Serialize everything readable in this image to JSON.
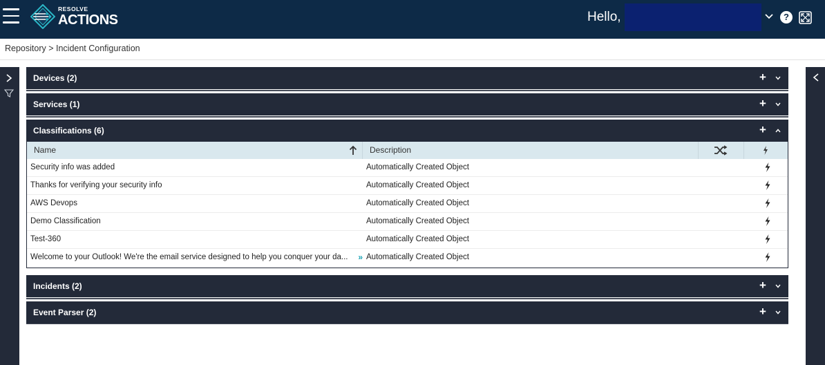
{
  "header": {
    "menu_icon": "hamburger-icon",
    "logo_line1": "RESOLVE",
    "logo_line2": "ACTIONS",
    "greeting": "Hello,",
    "colors": {
      "bar": "#0d2a47",
      "user_block": "#0b2170"
    }
  },
  "breadcrumb": "Repository > Incident Configuration",
  "panels": [
    {
      "title": "Devices (2)",
      "expanded": false
    },
    {
      "title": "Services (1)",
      "expanded": false
    },
    {
      "title": "Classifications (6)",
      "expanded": true
    },
    {
      "title": "Incidents (2)",
      "expanded": false
    },
    {
      "title": "Event Parser (2)",
      "expanded": false
    }
  ],
  "classifications_table": {
    "columns": [
      "Name",
      "Description"
    ],
    "sort": {
      "column": "Name",
      "direction": "ascending"
    },
    "rows": [
      {
        "name": "Security info was added",
        "description": "Automatically Created Object"
      },
      {
        "name": "Thanks for verifying your security info",
        "description": "Automatically Created Object"
      },
      {
        "name": "AWS Devops",
        "description": "Automatically Created Object"
      },
      {
        "name": "Demo Classification",
        "description": "Automatically Created Object"
      },
      {
        "name": "Test-360",
        "description": "Automatically Created Object"
      },
      {
        "name": "Welcome to your Outlook! We're the email service designed to help you conquer your da...",
        "description": "Automatically Created Object"
      }
    ]
  },
  "theme": {
    "panel": "#232a39",
    "table_header": "#d9e8ee",
    "accent": "#1aa3b5"
  }
}
